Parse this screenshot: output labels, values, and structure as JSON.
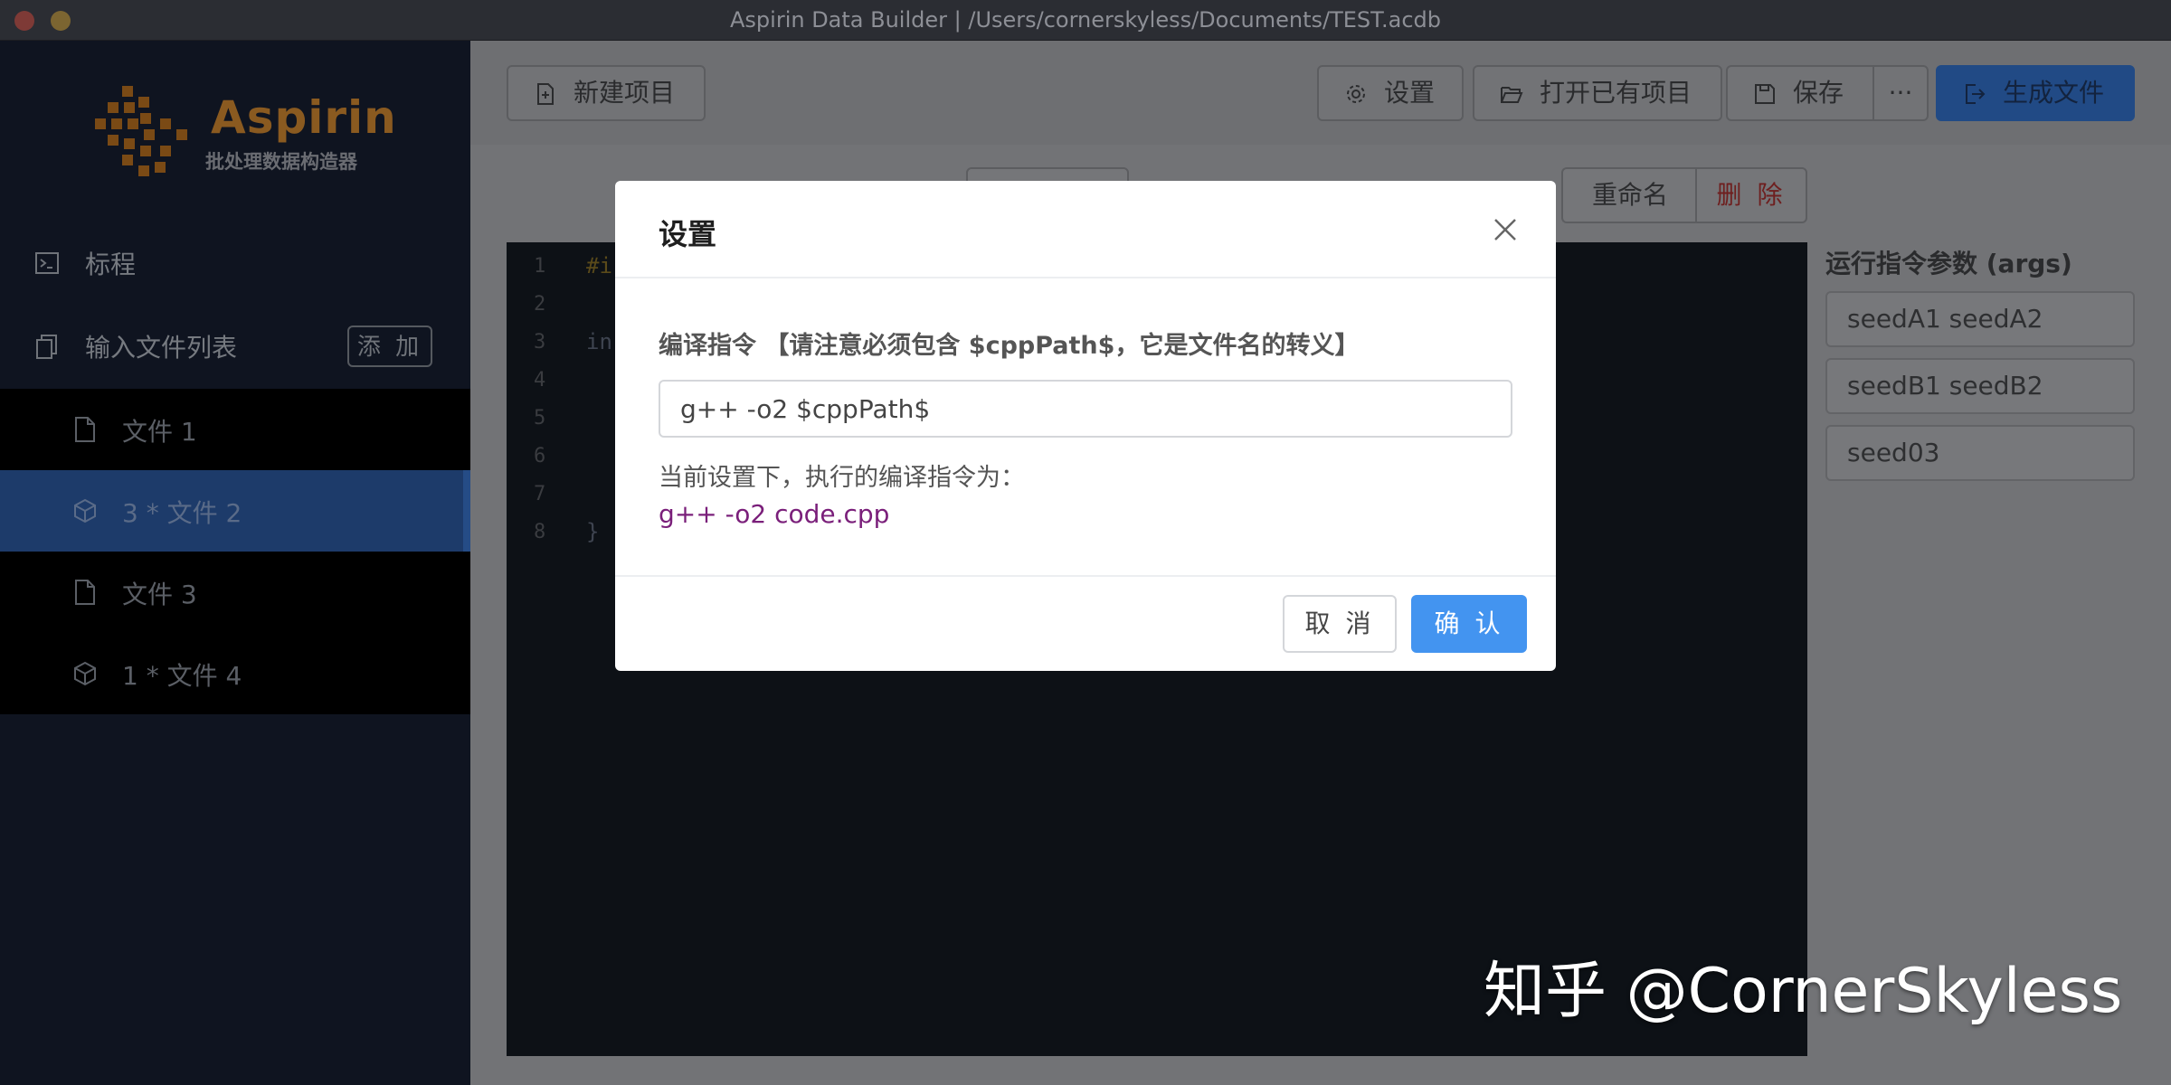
{
  "window": {
    "title": "Aspirin Data Builder | /Users/cornerskyless/Documents/TEST.acdb"
  },
  "sidebar": {
    "logo": {
      "name": "Aspirin",
      "subtitle": "批处理数据构造器"
    },
    "standard_label": "标程",
    "input_list_label": "输入文件列表",
    "add_label": "添 加",
    "files": [
      {
        "label": "文件 1",
        "icon": "file-icon",
        "selected": false
      },
      {
        "label": "3 * 文件 2",
        "icon": "cube-icon",
        "selected": true
      },
      {
        "label": "文件 3",
        "icon": "file-icon",
        "selected": false
      },
      {
        "label": "1 * 文件 4",
        "icon": "cube-icon",
        "selected": false
      }
    ]
  },
  "toolbar": {
    "new_project": "新建项目",
    "settings": "设置",
    "open_project": "打开已有项目",
    "save": "保存",
    "more": "···",
    "generate": "生成文件"
  },
  "file_actions": {
    "rename": "重命名",
    "delete": "删 除"
  },
  "editor": {
    "line_numbers": [
      "1",
      "2",
      "3",
      "4",
      "5",
      "6",
      "7",
      "8"
    ],
    "fragments": {
      "line1": "#i",
      "line3": "in",
      "line8": "}"
    }
  },
  "args": {
    "title": "运行指令参数 (args)",
    "items": [
      "seedA1 seedA2",
      "seedB1 seedB2",
      "seed03"
    ]
  },
  "dialog": {
    "title": "设置",
    "field_label": "编译指令 【请注意必须包含 $cppPath$，它是文件名的转义】",
    "input_value": "g++ -o2 $cppPath$",
    "hint": "当前设置下，执行的编译指令为：",
    "result": "g++ -o2 code.cpp",
    "cancel": "取 消",
    "confirm": "确 认"
  },
  "watermark": "知乎 @CornerSkyless",
  "colors": {
    "primary": "#4394f0",
    "result_text": "#7a1f7a",
    "delete_text": "#6e1f1f",
    "selected_row": "#1d3b6a"
  }
}
